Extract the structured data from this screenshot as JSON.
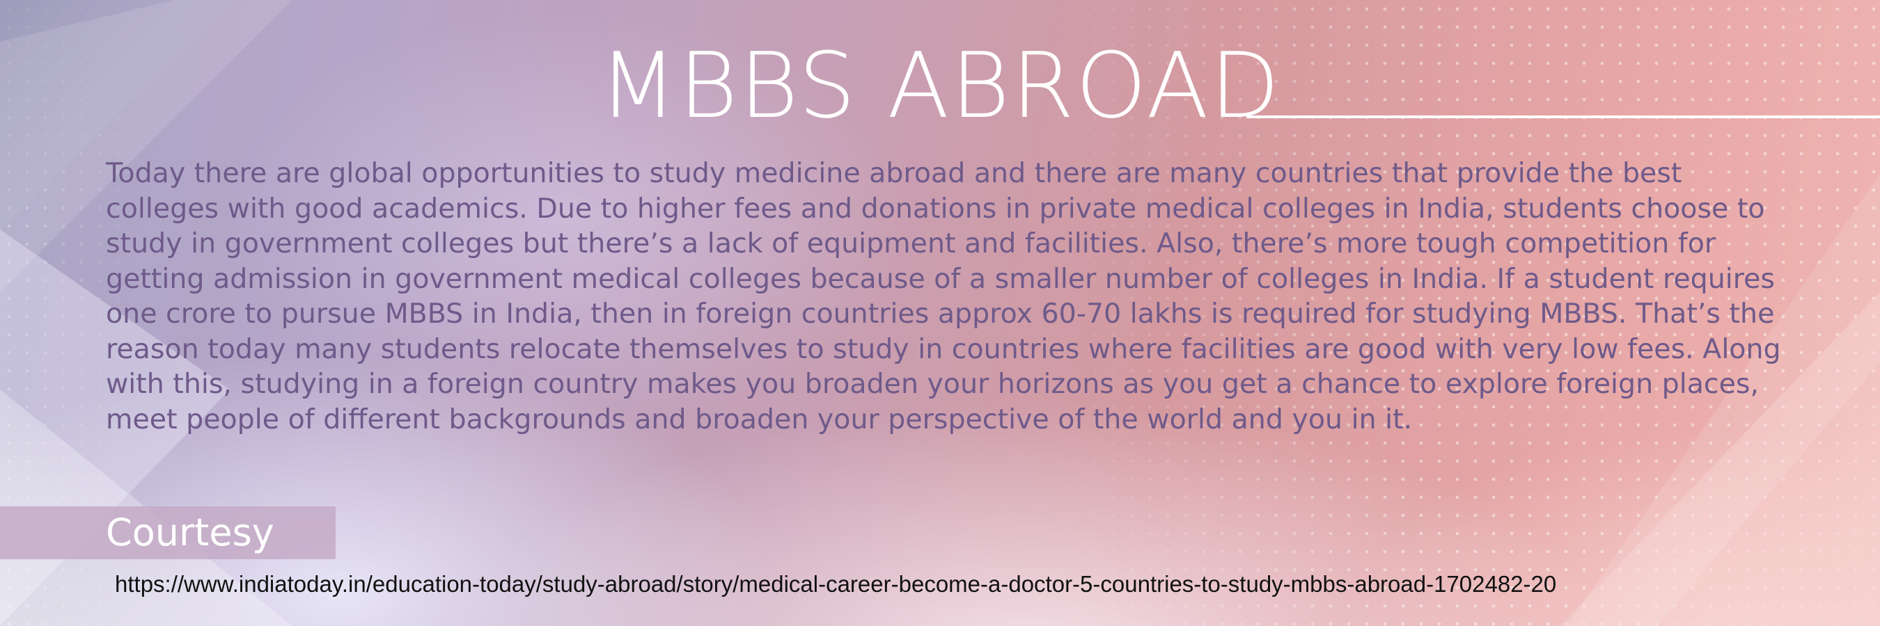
{
  "slide": {
    "title": "MBBS ABROAD",
    "body": "Today there are global opportunities to study medicine abroad and there are many countries that provide the best colleges with good academics. Due to higher fees and donations in private medical colleges in India, students choose to study in government colleges but there’s a lack of equipment and facilities. Also, there’s more tough competition for getting admission in government medical colleges because of a smaller number of colleges in India. If a student requires one crore to pursue MBBS in India, then in foreign countries approx 60-70 lakhs is required for studying MBBS. That’s the reason today many students relocate themselves to study in countries where facilities are good with very low fees. Along with this, studying in a foreign country makes you broaden your horizons as you get a chance to explore foreign places, meet people of different backgrounds and broaden your perspective of the world and you in it.",
    "courtesy_label": "Courtesy",
    "source_url": "https://www.indiatoday.in/education-today/study-abroad/story/medical-career-become-a-doctor-5-countries-to-study-mbbs-abroad-1702482-20"
  },
  "colors": {
    "title": "#ffffff",
    "body_text": "#6e5a8a",
    "courtesy_bar": "#c4aac6",
    "background_left": "#a9a7c6",
    "background_right": "#f0b7b3"
  }
}
